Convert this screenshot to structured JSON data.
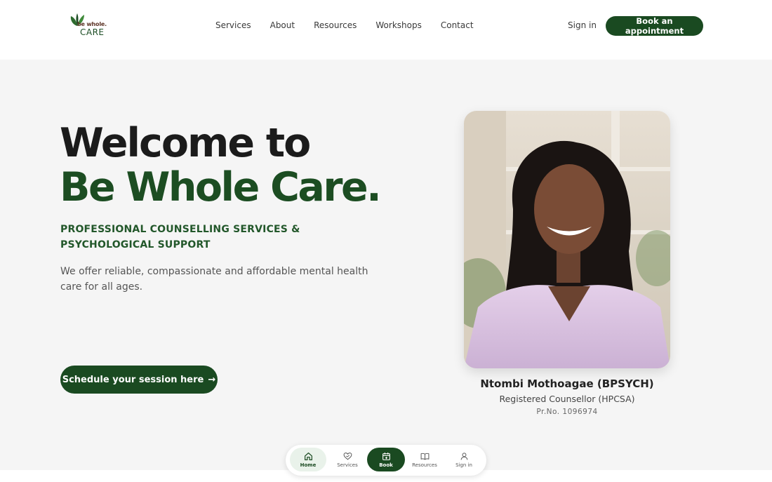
{
  "brand": {
    "logo_top": "be whole.",
    "logo_bottom": "CARE"
  },
  "nav": {
    "items": [
      "Services",
      "About",
      "Resources",
      "Workshops",
      "Contact"
    ],
    "sign_in": "Sign in",
    "book_button": "Book an appointment"
  },
  "hero": {
    "title_line1": "Welcome to",
    "title_line2": "Be Whole Care.",
    "subtitle": "PROFESSIONAL COUNSELLING SERVICES & PSYCHOLOGICAL SUPPORT",
    "description": "We offer reliable, compassionate and affordable mental health care for all ages.",
    "cta": "Schedule your session here",
    "cta_arrow": "→"
  },
  "counsellor": {
    "name": "Ntombi Mothoagae (BPSYCH)",
    "title": "Registered Counsellor (HPCSA)",
    "registration": "Pr.No. 1096974"
  },
  "tabbar": {
    "items": [
      {
        "label": "Home",
        "icon": "home-icon"
      },
      {
        "label": "Services",
        "icon": "heart-hands-icon"
      },
      {
        "label": "Book",
        "icon": "calendar-plus-icon"
      },
      {
        "label": "Resources",
        "icon": "book-open-icon"
      },
      {
        "label": "Sign in",
        "icon": "user-icon"
      }
    ]
  },
  "colors": {
    "brand_green": "#1a4a21",
    "accent_green": "#1c4d22",
    "hero_bg": "#f5f5f5"
  }
}
